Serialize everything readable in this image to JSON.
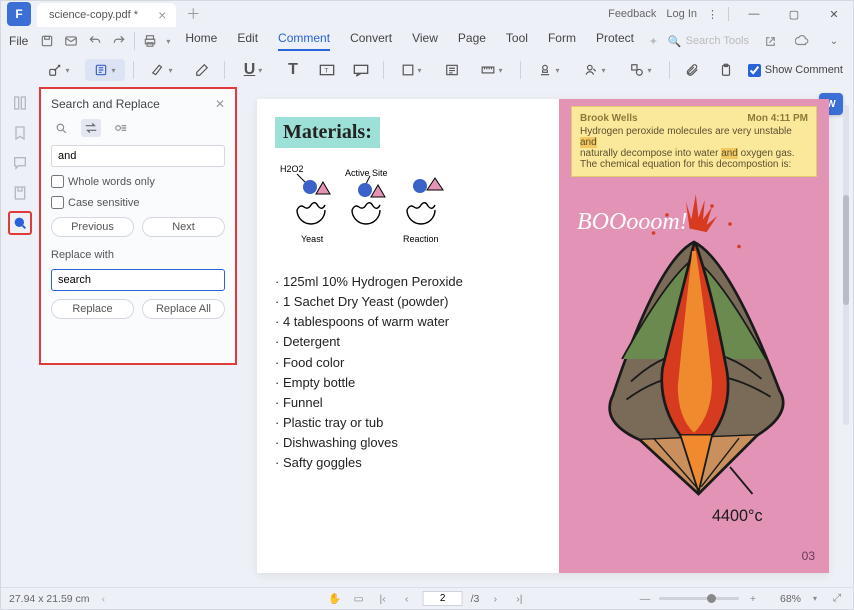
{
  "tab_title": "science-copy.pdf *",
  "titlebar": {
    "feedback": "Feedback",
    "login": "Log In"
  },
  "file_label": "File",
  "menu": [
    "Home",
    "Edit",
    "Comment",
    "Convert",
    "View",
    "Page",
    "Tool",
    "Form",
    "Protect"
  ],
  "menu_active_index": 2,
  "search_tools_placeholder": "Search Tools",
  "show_comment_label": "Show Comment",
  "search_panel": {
    "title": "Search and Replace",
    "find_value": "and",
    "whole_words": "Whole words only",
    "case_sensitive": "Case sensitive",
    "prev": "Previous",
    "next": "Next",
    "replace_with_label": "Replace with",
    "replace_value": "search",
    "replace": "Replace",
    "replace_all": "Replace All"
  },
  "document": {
    "materials_heading": "Materials:",
    "diagram_labels": {
      "h2o2": "H2O2",
      "active_site": "Active Site",
      "yeast": "Yeast",
      "reaction": "Reaction"
    },
    "materials": [
      "125ml 10% Hydrogen Peroxide",
      "1 Sachet Dry Yeast (powder)",
      "4 tablespoons of warm water",
      "Detergent",
      "Food color",
      "Empty bottle",
      "Funnel",
      "Plastic tray or tub",
      "Dishwashing gloves",
      "Safty goggles"
    ],
    "sticky": {
      "author": "Brook Wells",
      "time": "Mon 4:11 PM",
      "l1a": "Hydrogen peroxide molecules are very unstable ",
      "l1b": "and",
      "l2a": "naturally decompose into water ",
      "l2b": "and",
      "l2c": " oxygen gas.",
      "l3": "The chemical equation for this decompostion is:"
    },
    "boom": "BOOooom!",
    "temp_label": "4400°c",
    "page_num": "03"
  },
  "status": {
    "dims": "27.94 x 21.59 cm",
    "page_current": "2",
    "page_total": "/3",
    "zoom": "68%"
  }
}
